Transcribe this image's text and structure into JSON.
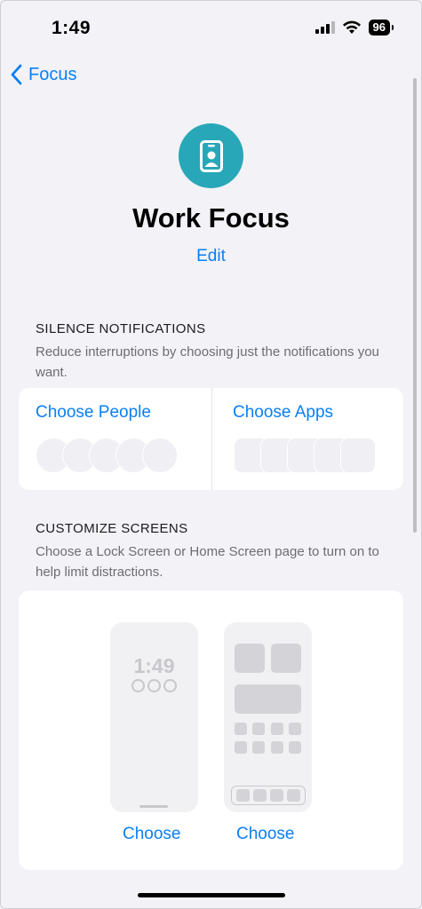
{
  "status_bar": {
    "time": "1:49",
    "battery": "96"
  },
  "nav": {
    "back_label": "Focus"
  },
  "header": {
    "title": "Work Focus",
    "edit_label": "Edit"
  },
  "silence": {
    "title": "SILENCE NOTIFICATIONS",
    "description": "Reduce interruptions by choosing just the notifications you want.",
    "people_label": "Choose People",
    "apps_label": "Choose Apps"
  },
  "customize": {
    "title": "CUSTOMIZE SCREENS",
    "description": "Choose a Lock Screen or Home Screen page to turn on to help limit distractions.",
    "lock_preview_time": "1:49",
    "lock_choose_label": "Choose",
    "home_choose_label": "Choose"
  },
  "colors": {
    "accent": "#0a7ff5",
    "focus_icon": "#28a7b8",
    "background": "#f2f2f7"
  },
  "icons": [
    "chevron-left-icon",
    "id-badge-icon",
    "wifi-icon",
    "cellular-signal-icon",
    "battery-icon"
  ]
}
